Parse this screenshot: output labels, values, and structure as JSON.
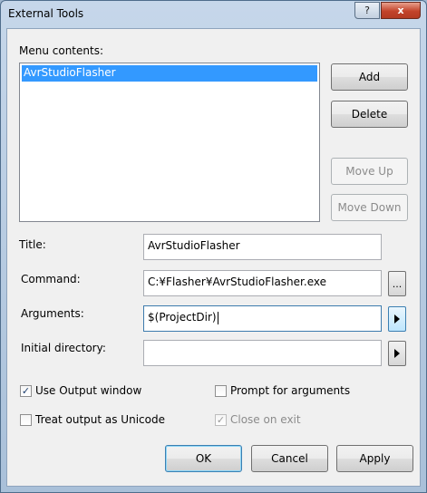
{
  "window": {
    "title": "External Tools",
    "help_glyph": "?",
    "close_glyph": "x"
  },
  "menu_contents": {
    "label": "Menu contents:",
    "items": [
      "AvrStudioFlasher"
    ],
    "selected_index": 0
  },
  "side_buttons": {
    "add": "Add",
    "delete": "Delete",
    "move_up": "Move Up",
    "move_down": "Move Down"
  },
  "fields": {
    "title": {
      "label": "Title:",
      "value": "AvrStudioFlasher"
    },
    "command": {
      "label": "Command:",
      "value": "C:¥Flasher¥AvrStudioFlasher.exe",
      "browse_label": "..."
    },
    "arguments": {
      "label": "Arguments:",
      "value": "$(ProjectDir)",
      "arrow_icon": "right-arrow-icon"
    },
    "initial_directory": {
      "label": "Initial directory:",
      "value": "",
      "arrow_icon": "right-arrow-icon"
    }
  },
  "options": {
    "use_output_window": {
      "label": "Use Output window",
      "checked": true
    },
    "prompt_for_arguments": {
      "label": "Prompt for arguments",
      "checked": false
    },
    "treat_output_unicode": {
      "label": "Treat output as Unicode",
      "checked": false
    },
    "close_on_exit": {
      "label": "Close on exit",
      "checked": true,
      "disabled": true
    }
  },
  "footer": {
    "ok": "OK",
    "cancel": "Cancel",
    "apply": "Apply"
  }
}
